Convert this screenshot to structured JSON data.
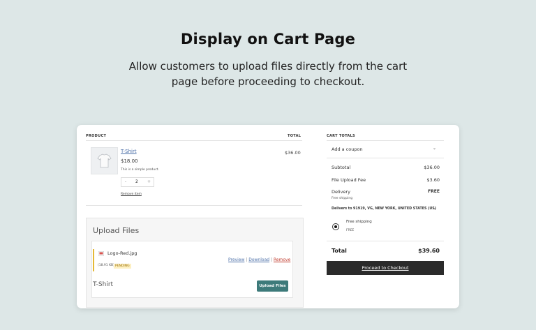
{
  "hero": {
    "title": "Display on Cart Page",
    "subtitle": "Allow customers to upload files directly from the cart page before proceeding to checkout."
  },
  "cart": {
    "headers": {
      "product": "PRODUCT",
      "total": "TOTAL"
    },
    "item": {
      "name": "T-Shirt",
      "price": "$18.00",
      "description": "This is a simple product.",
      "quantity": "2",
      "qty_minus": "-",
      "qty_plus": "+",
      "remove": "Remove item",
      "line_total": "$36.00"
    }
  },
  "upload": {
    "title": "Upload Files",
    "file_name": "Logo-Red.jpg",
    "file_size": "(18.91 KB)",
    "status": "PENDING",
    "preview": "Preview",
    "download": "Download",
    "remove": "Remove",
    "sep": "|",
    "product_label": "T-Shirt",
    "button": "Upload Files"
  },
  "totals": {
    "header": "CART TOTALS",
    "coupon": "Add a coupon",
    "subtotal_label": "Subtotal",
    "subtotal_value": "$36.00",
    "fee_label": "File Upload Fee",
    "fee_value": "$3.60",
    "delivery_label": "Delivery",
    "delivery_value": "FREE",
    "delivery_note": "Free shipping",
    "delivers_to": "Delivers to 91919, VG, NEW YORK, UNITED STATES (US)",
    "shipping_option": "Free shipping",
    "shipping_option_price": "FREE",
    "total_label": "Total",
    "total_value": "$39.60",
    "checkout": "Proceed to Checkout"
  },
  "colors": {
    "background": "#dde7e7",
    "upload_button": "#3d7a7a",
    "checkout_button": "#2b2b2b",
    "pending_accent": "#e5b936",
    "remove_link": "#c0392b",
    "link": "#4b6fa8"
  },
  "icons": {
    "product_thumbnail": "tshirt-icon",
    "file_thumbnail": "image-file-icon",
    "coupon_toggle": "chevron-down-icon",
    "address_toggle": "chevron-down-icon"
  }
}
